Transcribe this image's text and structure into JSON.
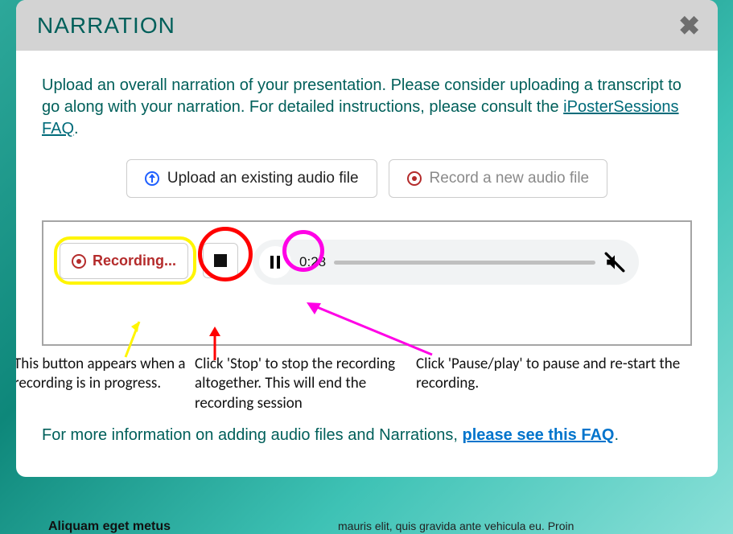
{
  "modal": {
    "title": "NARRATION",
    "intro_part1": "Upload an overall narration of your presentation. Please consider uploading a transcript to go along with your narration. For detailed instructions, please consult the ",
    "intro_link": "iPosterSessions FAQ",
    "intro_part2": ".",
    "upload_btn": "Upload an existing audio file",
    "record_btn": "Record a new audio file",
    "recording_label": "Recording...",
    "player_time": "0:28",
    "footer_text": "For more information on adding audio files and Narrations, ",
    "footer_link": "please see this FAQ",
    "footer_tail": "."
  },
  "annotations": {
    "a1": "This button appears when a recording is in progress.",
    "a2": "Click 'Stop' to stop the recording altogether. This will end the recording session",
    "a3": "Click 'Pause/play' to pause and re-start the recording."
  },
  "backdrop": {
    "left": "Aliquam eget metus",
    "right": "mauris elit, quis gravida ante vehicula eu. Proin"
  }
}
